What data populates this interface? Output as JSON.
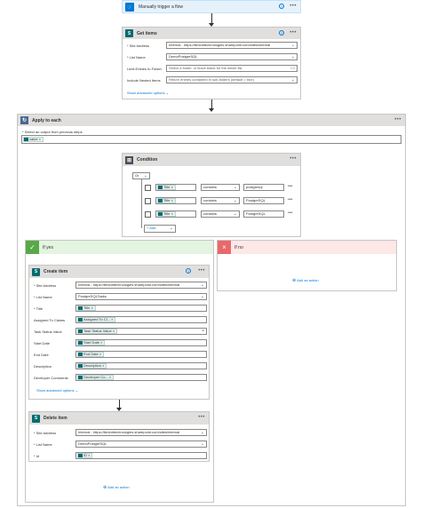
{
  "trigger": {
    "title": "Manually trigger a flow"
  },
  "get_items": {
    "title": "Get items",
    "rows": [
      {
        "label": "* Site Address",
        "value": "Internal - https://tbnlobtechnologies.sharepoint.com/sites/internal",
        "kind": "select"
      },
      {
        "label": "* List Name",
        "value": "DemoPostgreSQL",
        "kind": "select"
      },
      {
        "label": "Limit Entries to Folder",
        "value": "Select a folder, or leave blank for the whole list",
        "kind": "folder"
      },
      {
        "label": "Include Nested Items",
        "value": "Return entries contained in sub-folders (default = true)",
        "kind": "select"
      }
    ],
    "advanced": "Show advanced options"
  },
  "apply_each": {
    "title": "Apply to each",
    "select_label": "* Select an output from previous steps",
    "token": "value"
  },
  "condition": {
    "title": "Condition",
    "operator": "Or",
    "rows": [
      {
        "token": "Title",
        "op": "contains",
        "value": "postgresql"
      },
      {
        "token": "Title",
        "op": "contains",
        "value": "PostgreSQL"
      },
      {
        "token": "Title",
        "op": "contains",
        "value": "PostgreSQL"
      }
    ],
    "add": "Add"
  },
  "if_yes": {
    "label": "If yes"
  },
  "if_no": {
    "label": "If no",
    "add_action": "Add an action"
  },
  "create_item": {
    "title": "Create item",
    "rows": [
      {
        "label": "* Site Address",
        "value": "Internal - https://tbnlobtechnologies.sharepoint.com/sites/internal",
        "kind": "select"
      },
      {
        "label": "* List Name",
        "value": "PostgreSQLTasks",
        "kind": "select"
      },
      {
        "label": "* Title",
        "value": "Title",
        "kind": "token"
      },
      {
        "label": "Assigned To Claims",
        "value": "Assigned To Cl...",
        "kind": "token"
      },
      {
        "label": "Task Status Value",
        "value": "Task Status Value",
        "kind": "token-x"
      },
      {
        "label": "Start Date",
        "value": "Start Date",
        "kind": "token"
      },
      {
        "label": "End Date",
        "value": "End Date",
        "kind": "token"
      },
      {
        "label": "Description",
        "value": "Description",
        "kind": "token"
      },
      {
        "label": "Developer Comments",
        "value": "Developer Co...",
        "kind": "token"
      }
    ],
    "advanced": "Show advanced options"
  },
  "delete_item": {
    "title": "Delete item",
    "rows": [
      {
        "label": "* Site Address",
        "value": "Internal - https://tbnlobtechnologies.sharepoint.com/sites/internal",
        "kind": "select"
      },
      {
        "label": "* List Name",
        "value": "DemoPostgreSQL",
        "kind": "select"
      },
      {
        "label": "* Id",
        "value": "ID",
        "kind": "token"
      }
    ]
  },
  "yes_add_action": "Add an action",
  "colors": {
    "accent": "#0078d4",
    "sharepoint": "#036c70",
    "trigger_bg": "#e6f2fb",
    "yes_bg": "#e3f4e0",
    "no_bg": "#fde7e7"
  }
}
